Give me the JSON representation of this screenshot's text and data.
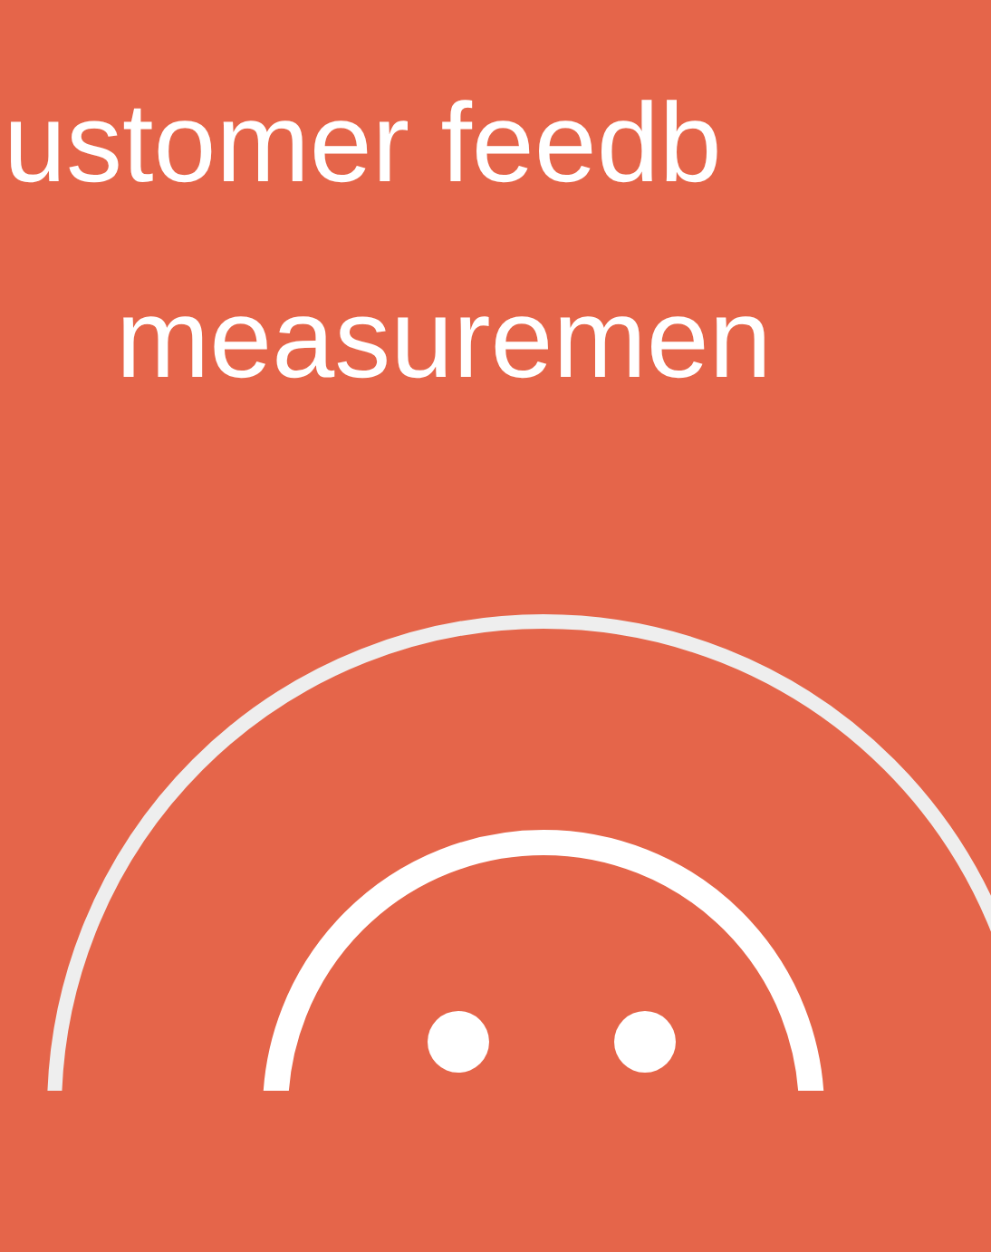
{
  "headline": {
    "lines": [
      "ustomer feedb",
      "measuremen"
    ]
  }
}
